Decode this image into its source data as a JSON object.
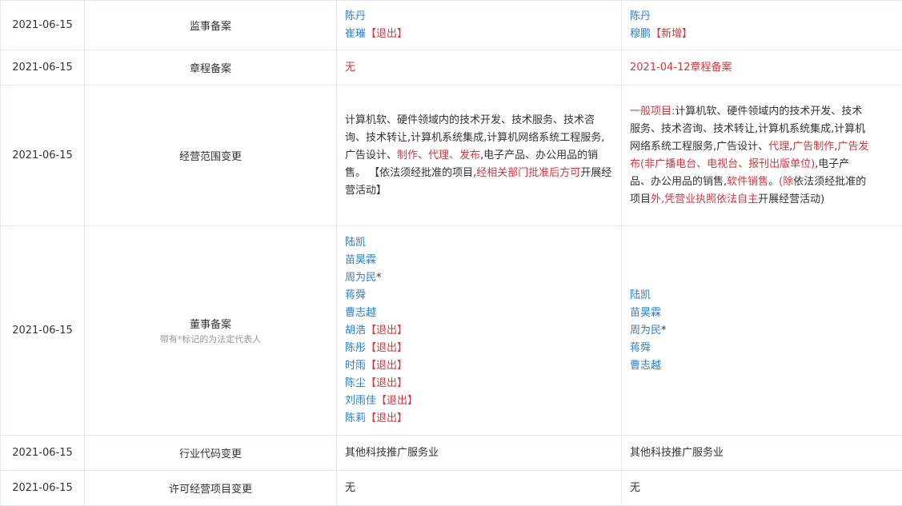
{
  "rows": [
    {
      "date": "2021-06-15",
      "type": "监事备案",
      "before": [
        {
          "name": "陈丹",
          "tag": ""
        },
        {
          "name": "崔璀",
          "tag": "【退出】"
        }
      ],
      "after": [
        {
          "name": "陈丹",
          "tag": ""
        },
        {
          "name": "穆鹏",
          "tag": "【新增】"
        }
      ]
    },
    {
      "date": "2021-06-15",
      "type": "章程备案",
      "before": "无",
      "after": "2021-04-12章程备案"
    },
    {
      "date": "2021-06-15",
      "type": "经营范围变更",
      "before_segments": [
        {
          "t": "计算机软、硬件领域内的技术开发、技术服务、技术咨询、技术转让,计算机系统集成,计算机网络系统工程服务,广告设计、",
          "red": false
        },
        {
          "t": "制作、代理、发布",
          "red": true
        },
        {
          "t": ",电子产品、办公用品的销售。 【依法须经批准的项目,",
          "red": false
        },
        {
          "t": "经相关部门批准后方可",
          "red": true
        },
        {
          "t": "开展经营活动】",
          "red": false
        }
      ],
      "after_segments": [
        {
          "t": "一般项目:",
          "red": true
        },
        {
          "t": "计算机软、硬件领域内的技术开发、技术服务、技术咨询、技术转让,计算机系统集成,计算机网络系统工程服务,广告设计、",
          "red": false
        },
        {
          "t": "代理",
          "red": true
        },
        {
          "t": ",",
          "red": false
        },
        {
          "t": "广告制作",
          "red": true
        },
        {
          "t": ",",
          "red": false
        },
        {
          "t": "广告发布(非广播电台、电视台、报刊出版单位)",
          "red": true
        },
        {
          "t": ",电子产品、办公用品的销售,",
          "red": false
        },
        {
          "t": "软件销售",
          "red": true
        },
        {
          "t": "。",
          "red": false
        },
        {
          "t": "(除",
          "red": true
        },
        {
          "t": "依法须经批准的项目",
          "red": false
        },
        {
          "t": "外,凭营业执照依法自主",
          "red": true
        },
        {
          "t": "开展经营活动)",
          "red": false
        }
      ]
    },
    {
      "date": "2021-06-15",
      "type": "董事备案",
      "note": "带有*标记的为法定代表人",
      "before": [
        {
          "name": "陆凯",
          "tag": ""
        },
        {
          "name": "苗昊霖",
          "tag": ""
        },
        {
          "name": "周为民",
          "star": "*",
          "tag": ""
        },
        {
          "name": "蒋舜",
          "tag": ""
        },
        {
          "name": "曹志越",
          "tag": ""
        },
        {
          "name": "胡浩",
          "tag": "【退出】"
        },
        {
          "name": "陈彤",
          "tag": "【退出】"
        },
        {
          "name": "时雨",
          "tag": "【退出】"
        },
        {
          "name": "陈尘",
          "tag": "【退出】"
        },
        {
          "name": "刘雨佳",
          "tag": "【退出】"
        },
        {
          "name": "陈莉",
          "tag": "【退出】"
        }
      ],
      "after": [
        {
          "name": "陆凯",
          "tag": ""
        },
        {
          "name": "苗昊霖",
          "tag": ""
        },
        {
          "name": "周为民",
          "star": "*",
          "tag": ""
        },
        {
          "name": "蒋舜",
          "tag": ""
        },
        {
          "name": "曹志越",
          "tag": ""
        }
      ]
    },
    {
      "date": "2021-06-15",
      "type": "行业代码变更",
      "before": "其他科技推广服务业",
      "after": "其他科技推广服务业"
    },
    {
      "date": "2021-06-15",
      "type": "许可经营项目变更",
      "before": "无",
      "after": "无"
    }
  ],
  "colors": {
    "link": "#2a7fd0",
    "highlight": "#d9363e",
    "border": "#e4e8ef"
  }
}
